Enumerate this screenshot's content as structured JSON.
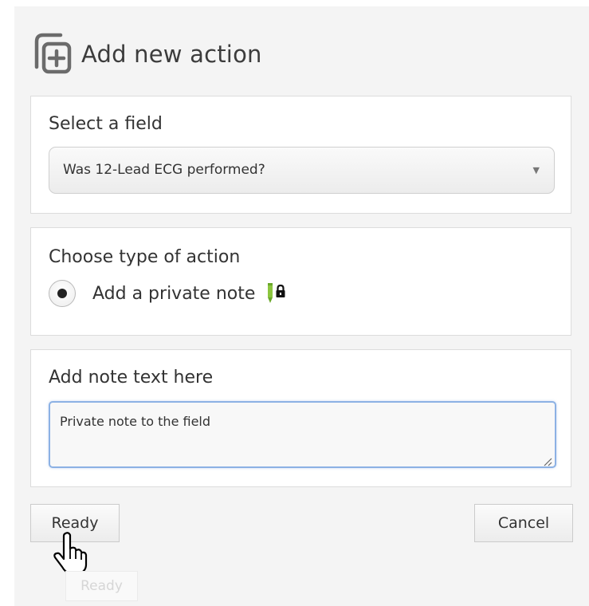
{
  "header": {
    "title": "Add new action",
    "icon": "add-action-icon"
  },
  "field_section": {
    "label": "Select a field",
    "selected_value": "Was 12-Lead ECG performed?",
    "arrow_icon": "dropdown-arrow-icon"
  },
  "action_section": {
    "label": "Choose type of action",
    "option_label": "Add a private note",
    "option_selected": true,
    "note_icon": "private-note-icon"
  },
  "note_section": {
    "label": "Add note text here",
    "value": "Private note to the field"
  },
  "buttons": {
    "ready_label": "Ready",
    "cancel_label": "Cancel"
  },
  "tooltip": {
    "text": "Ready"
  },
  "colors": {
    "panel_bg": "#f4f4f4",
    "focus_border": "#8cb1e4",
    "note_icon_green": "#8cc63f"
  }
}
